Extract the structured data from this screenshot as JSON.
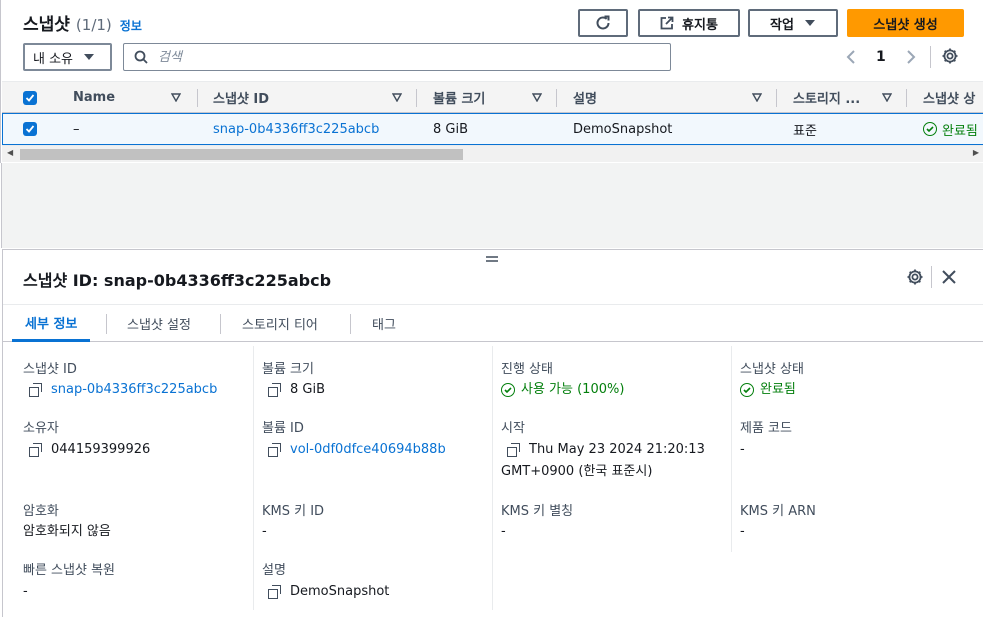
{
  "header": {
    "title": "스냅샷",
    "count": "(1/1)",
    "info": "정보"
  },
  "toolbar": {
    "recycle_label": "휴지통",
    "actions_label": "작업",
    "create_label": "스냅샷 생성"
  },
  "filter": {
    "owner_value": "내 소유",
    "search_placeholder": "검색"
  },
  "pager": {
    "page": "1"
  },
  "table": {
    "columns": [
      "Name",
      "스냅샷 ID",
      "볼륨 크기",
      "설명",
      "스토리지 ...",
      "스냅샷 상"
    ],
    "row": {
      "name": "–",
      "snapshot_id": "snap-0b4336ff3c225abcb",
      "volume_size": "8 GiB",
      "description": "DemoSnapshot",
      "storage_tier": "표준",
      "snapshot_status": "완료됨"
    }
  },
  "details": {
    "title": "스냅샷 ID: snap-0b4336ff3c225abcb",
    "tabs": [
      "세부 정보",
      "스냅샷 설정",
      "스토리지 티어",
      "태그"
    ],
    "fields": {
      "snapshot_id": {
        "label": "스냅샷 ID",
        "value": "snap-0b4336ff3c225abcb"
      },
      "volume_size": {
        "label": "볼륨 크기",
        "value": "8 GiB"
      },
      "progress": {
        "label": "진행 상태",
        "value": "사용 가능 (100%)"
      },
      "snapshot_status": {
        "label": "스냅샷 상태",
        "value": "완료됨"
      },
      "owner": {
        "label": "소유자",
        "value": "044159399926"
      },
      "volume_id": {
        "label": "볼륨 ID",
        "value": "vol-0df0dfce40694b88b"
      },
      "start": {
        "label": "시작",
        "value_line1": "Thu May 23 2024 21:20:13",
        "value_line2": "GMT+0900 (한국 표준시)"
      },
      "product_code": {
        "label": "제품 코드",
        "value": "-"
      },
      "encryption": {
        "label": "암호화",
        "value": "암호화되지 않음"
      },
      "kms_key_id": {
        "label": "KMS 키 ID",
        "value": "-"
      },
      "kms_key_alias": {
        "label": "KMS 키 별칭",
        "value": "-"
      },
      "kms_key_arn": {
        "label": "KMS 키 ARN",
        "value": "-"
      },
      "fast_restore": {
        "label": "빠른 스냅샷 복원",
        "value": "-"
      },
      "description": {
        "label": "설명",
        "value": "DemoSnapshot"
      }
    }
  },
  "colors": {
    "accent": "#0972d3",
    "primary_button": "#ff9900",
    "success": "#037f0c"
  },
  "icons": [
    "refresh-icon",
    "external-link-icon",
    "caret-down-icon",
    "search-icon",
    "chevron-left-icon",
    "chevron-right-icon",
    "gear-icon",
    "sort-icon",
    "check-icon",
    "copy-icon",
    "status-ok-icon",
    "close-icon",
    "drag-handle-icon"
  ]
}
